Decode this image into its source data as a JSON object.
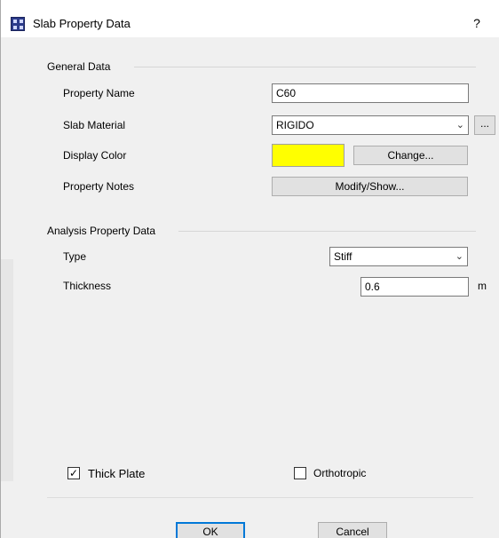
{
  "window": {
    "title": "Slab Property Data",
    "help_label": "?"
  },
  "general": {
    "group_label": "General Data",
    "property_name_label": "Property Name",
    "property_name_value": "C60",
    "slab_material_label": "Slab Material",
    "slab_material_value": "RIGIDO",
    "material_browse_label": "...",
    "display_color_label": "Display Color",
    "display_color": "#ffff00",
    "change_label": "Change...",
    "property_notes_label": "Property Notes",
    "modify_show_label": "Modify/Show..."
  },
  "analysis": {
    "group_label": "Analysis Property Data",
    "type_label": "Type",
    "type_value": "Stiff",
    "thickness_label": "Thickness",
    "thickness_value": "0.6",
    "thickness_unit": "m"
  },
  "options": {
    "thick_plate_label": "Thick Plate",
    "thick_plate_checked": true,
    "thick_plate_mark": "✓",
    "orthotropic_label": "Orthotropic",
    "orthotropic_checked": false
  },
  "buttons": {
    "ok_label": "OK",
    "cancel_label": "Cancel"
  }
}
